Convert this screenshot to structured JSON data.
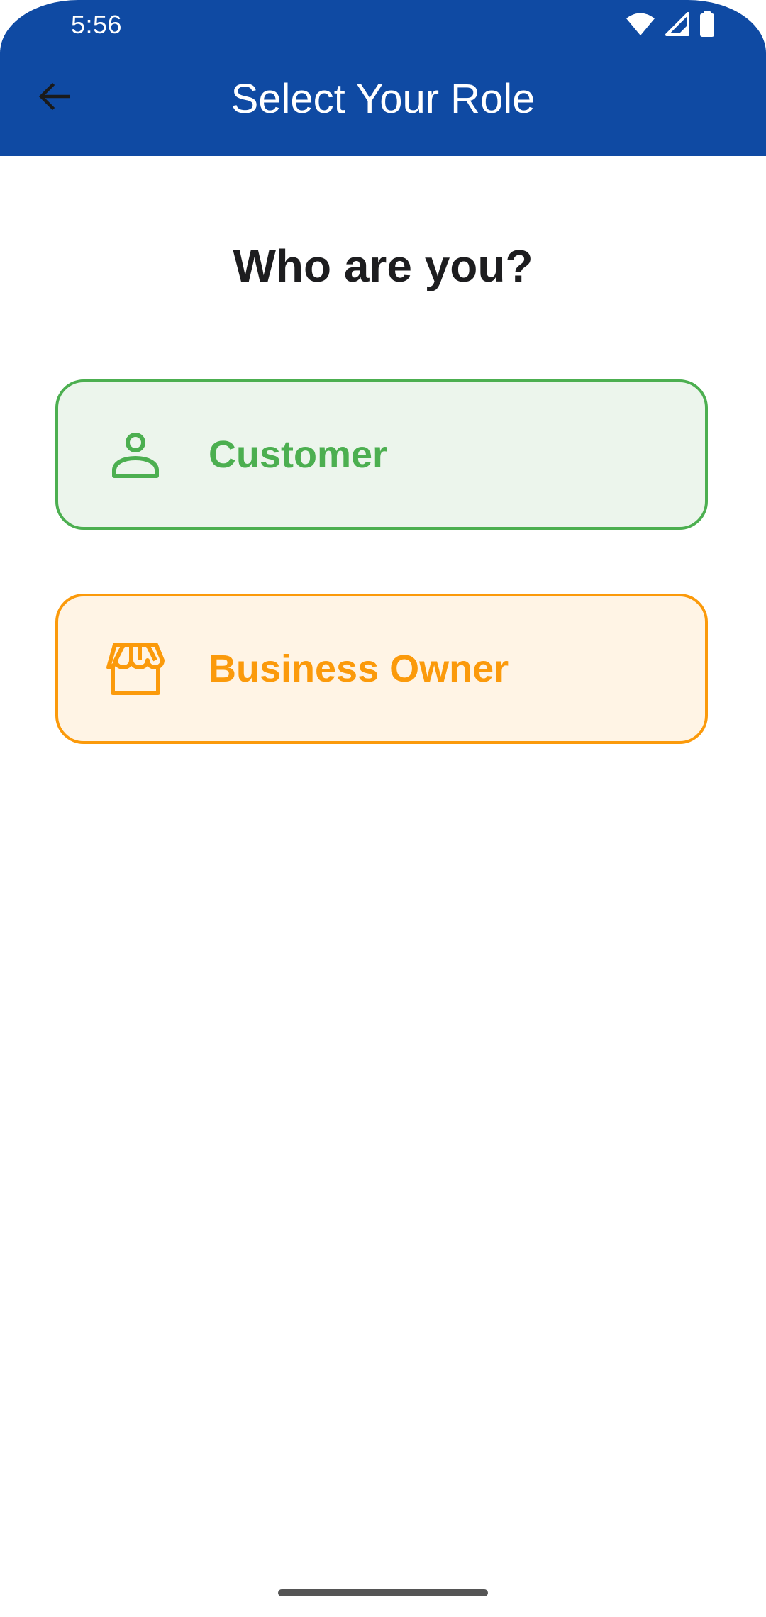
{
  "status_bar": {
    "time": "5:56",
    "icons": [
      "wifi-icon",
      "cellular-signal-icon",
      "battery-icon"
    ]
  },
  "app_bar": {
    "title": "Select Your Role",
    "back_icon": "arrow-back-icon",
    "background_color": "#0f4aa3"
  },
  "main": {
    "heading": "Who are you?",
    "roles": [
      {
        "label": "Customer",
        "icon": "person-icon",
        "accent_color": "#4caf50",
        "background_color": "#ecf5ec"
      },
      {
        "label": "Business Owner",
        "icon": "storefront-icon",
        "accent_color": "#fb9a0b",
        "background_color": "#fff4e5"
      }
    ]
  }
}
